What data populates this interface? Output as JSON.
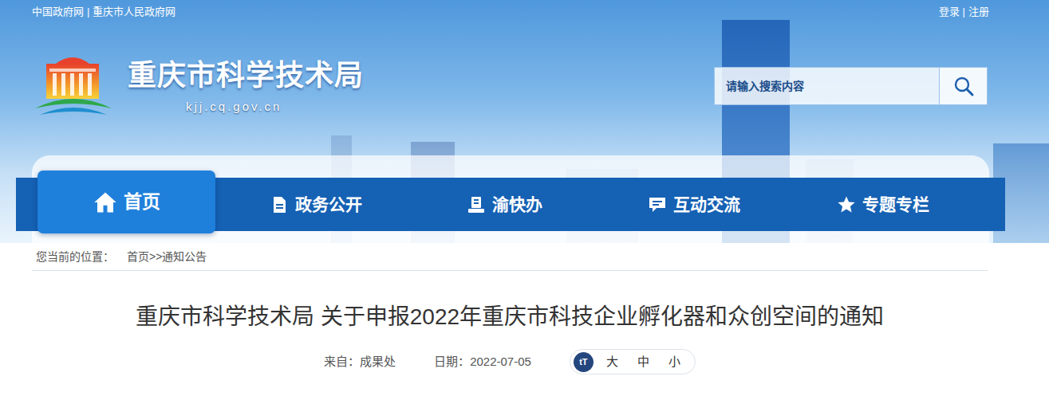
{
  "top_links": {
    "items": [
      "中国政府网",
      "重庆市人民政府网"
    ],
    "separator": "|"
  },
  "user_links": {
    "items": [
      "登录",
      "注册"
    ],
    "separator": "|"
  },
  "site": {
    "title": "重庆市科学技术局",
    "domain": "kjj.cq.gov.cn"
  },
  "search": {
    "placeholder": "请输入搜索内容"
  },
  "nav": [
    {
      "label": "首页",
      "selected": true,
      "kind": "home"
    },
    {
      "label": "政务公开",
      "selected": false,
      "kind": "document"
    },
    {
      "label": "渝快办",
      "selected": false,
      "kind": "service"
    },
    {
      "label": "互动交流",
      "selected": false,
      "kind": "chat"
    },
    {
      "label": "专题专栏",
      "selected": false,
      "kind": "star"
    }
  ],
  "breadcrumb": {
    "prefix": "您当前的位置：",
    "items": [
      "首页",
      "通知公告"
    ],
    "separator": ">>"
  },
  "article": {
    "title": "重庆市科学技术局 关于申报2022年重庆市科技企业孵化器和众创空间的通知",
    "source_label": "来自：",
    "source": "成果处",
    "date_label": "日期：",
    "date": "2022-07-05"
  },
  "font_size": {
    "icon": "tT",
    "options": [
      "大",
      "中",
      "小"
    ]
  }
}
